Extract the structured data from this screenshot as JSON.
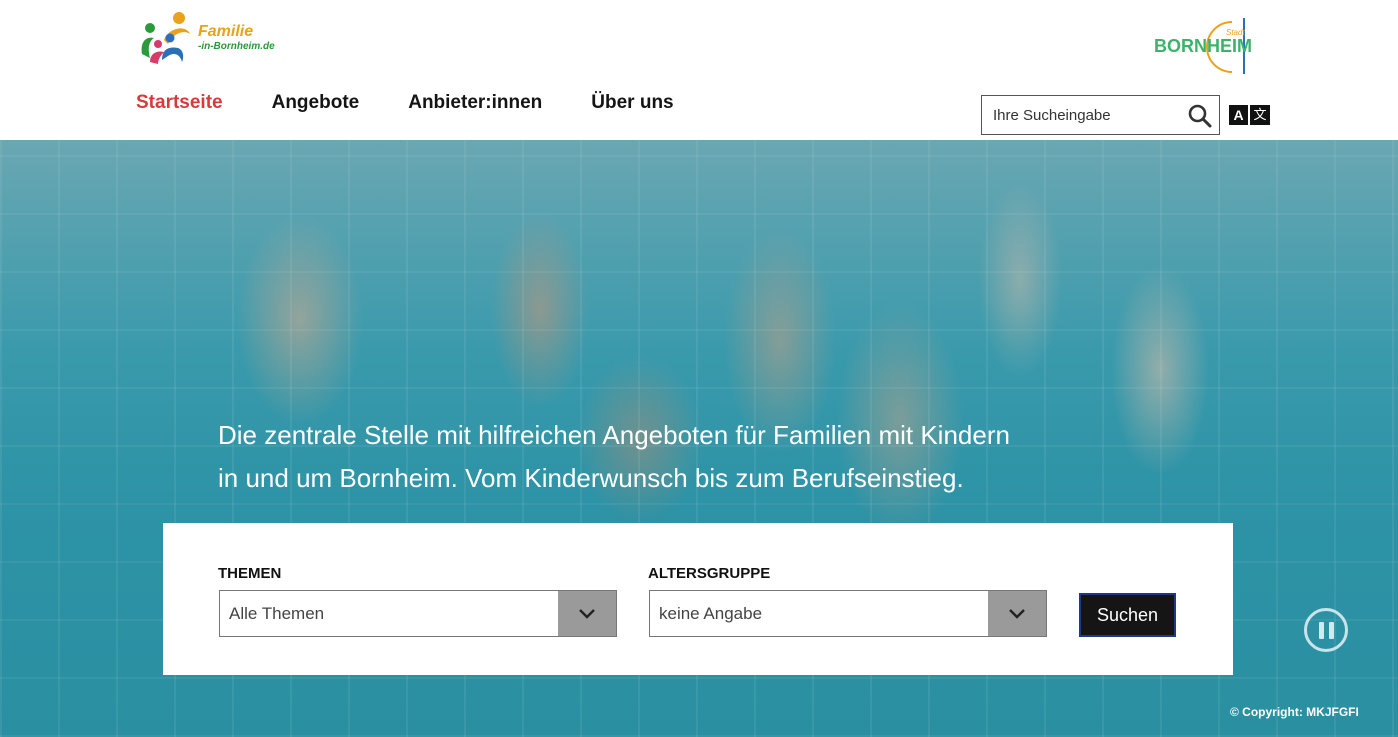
{
  "brand": {
    "logo_line1": "Familie",
    "logo_line2": "-in-Bornheim.de",
    "city_name": "BORNHEIM",
    "city_prefix": "Stadt"
  },
  "nav": {
    "items": [
      {
        "label": "Startseite",
        "active": true
      },
      {
        "label": "Angebote",
        "active": false
      },
      {
        "label": "Anbieter:innen",
        "active": false
      },
      {
        "label": "Über uns",
        "active": false
      }
    ]
  },
  "search": {
    "placeholder": "Ihre Sucheingabe",
    "icon": "search-icon"
  },
  "language": {
    "icon": "translate-icon",
    "glyph_a": "A",
    "glyph_b": "文"
  },
  "hero": {
    "line1": "Die zentrale Stelle mit hilfreichen Angeboten für Familien mit Kindern",
    "line2": "in und um Bornheim. Vom Kinderwunsch bis zum Berufseinstieg.",
    "copyright": "© Copyright: MKJFGFI"
  },
  "filter": {
    "themen_label": "THEMEN",
    "themen_value": "Alle Themen",
    "alters_label": "ALTERSGRUPPE",
    "alters_value": "keine Angabe",
    "submit_label": "Suchen"
  },
  "colors": {
    "active_nav": "#d83a3a",
    "brand_green": "#3bb46a",
    "brand_orange": "#e9a21b",
    "select_arrow_bg": "#9a9a9a",
    "button_bg": "#151515"
  }
}
